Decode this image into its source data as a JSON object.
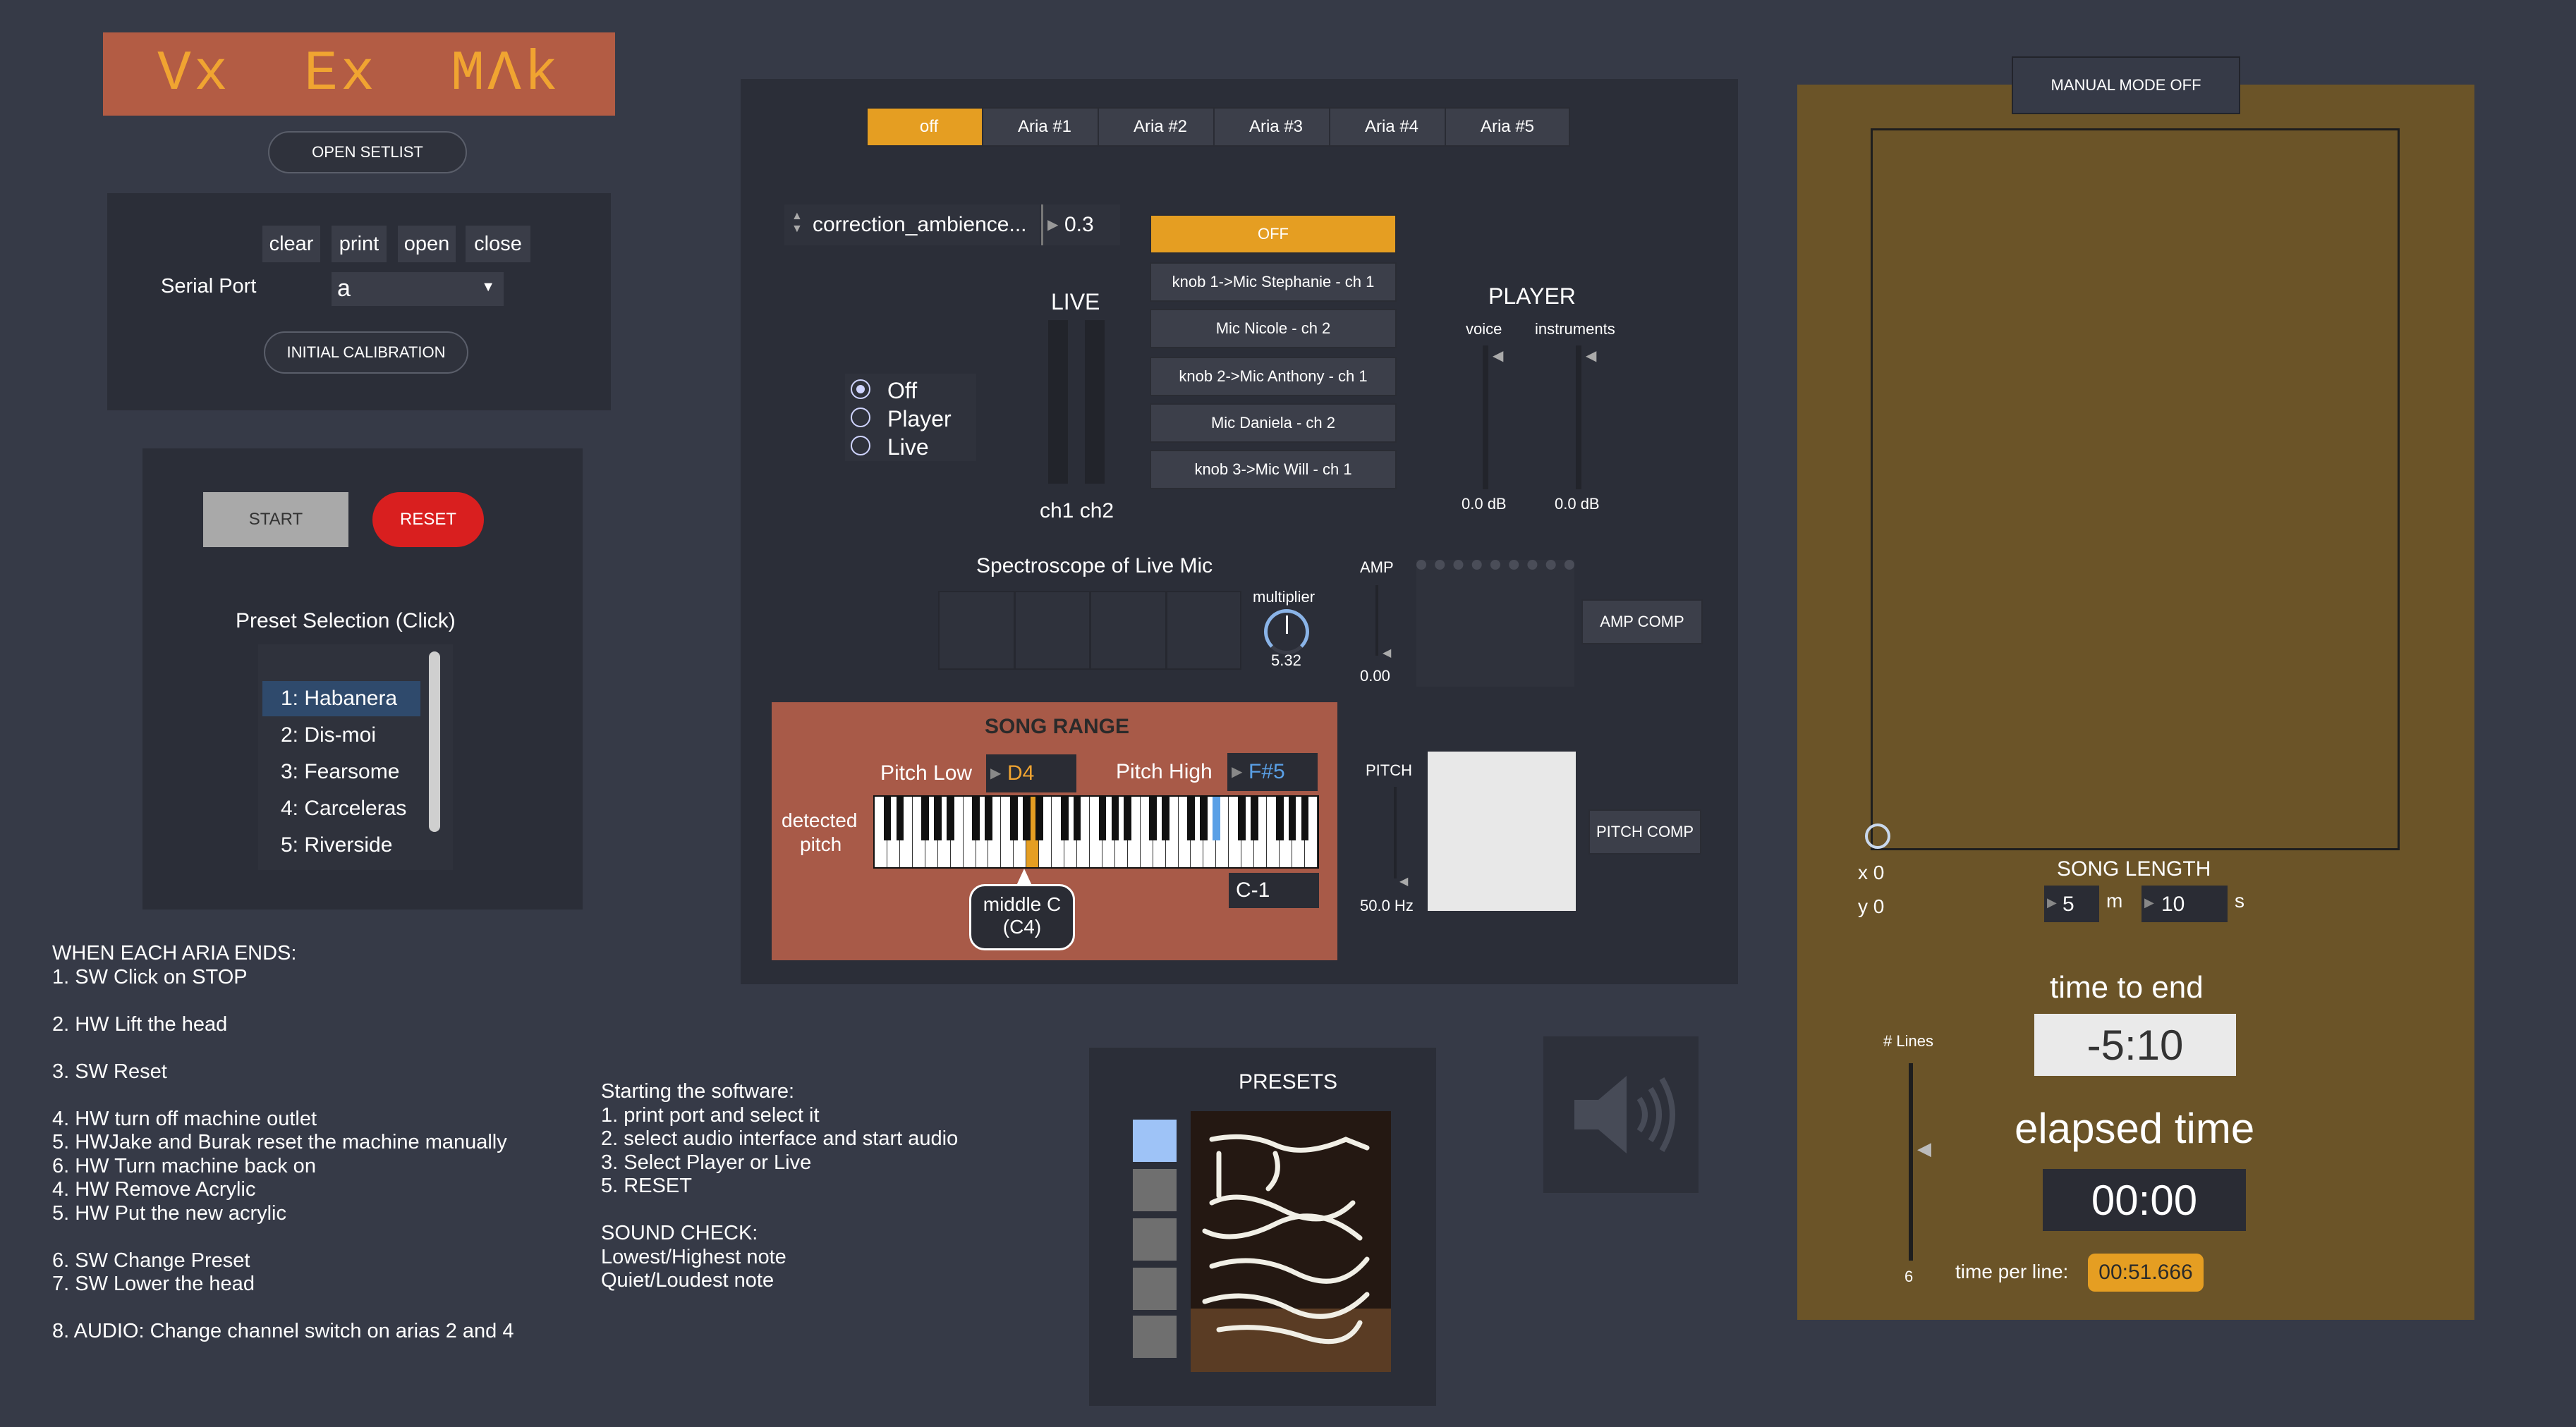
{
  "header": {
    "title": "Vx  Ex  MΛk",
    "open_setlist": "OPEN SETLIST"
  },
  "serial": {
    "clear": "clear",
    "print": "print",
    "open": "open",
    "close": "close",
    "label": "Serial Port",
    "port_value": "a",
    "initial_calibration": "INITIAL CALIBRATION"
  },
  "transport": {
    "start": "START",
    "reset": "RESET"
  },
  "presets_list": {
    "title": "Preset Selection (Click)",
    "items": [
      "1: Habanera",
      "2: Dis-moi",
      "3: Fearsome",
      "4: Carceleras",
      "5: Riverside"
    ],
    "selected_index": 0
  },
  "notes_left": "WHEN EACH ARIA ENDS:\n1. SW Click on STOP\n\n2. HW Lift the head\n\n3. SW Reset\n\n4. HW turn off machine outlet\n5. HWJake and Burak reset the machine manually\n6. HW Turn machine back on\n4. HW Remove Acrylic\n5. HW Put the new acrylic\n\n6. SW Change Preset\n7. SW Lower the head\n\n8. AUDIO: Change channel switch on arias 2 and 4",
  "notes_mid": "Starting the software:\n1. print port and select it\n2. select audio interface and start audio\n3. Select Player or Live\n5. RESET\n\nSOUND CHECK:\nLowest/Highest note\nQuiet/Loudest note",
  "tabs": [
    "off",
    "Aria #1",
    "Aria #2",
    "Aria #3",
    "Aria #4",
    "Aria #5"
  ],
  "param": {
    "name": "correction_ambience...",
    "value": "0.3"
  },
  "mode": {
    "options": [
      "Off",
      "Player",
      "Live"
    ],
    "selected": "Off"
  },
  "live": {
    "title": "LIVE",
    "channels": "ch1 ch2"
  },
  "mics": {
    "off_button": "OFF",
    "items": [
      "knob 1->Mic Stephanie - ch 1",
      "Mic Nicole - ch 2",
      "knob 2->Mic Anthony - ch 1",
      "Mic Daniela - ch 2",
      "knob 3->Mic Will - ch 1"
    ]
  },
  "player": {
    "title": "PLAYER",
    "voice": "voice",
    "instruments": "instruments",
    "voice_db": "0.0 dB",
    "instruments_db": "0.0 dB"
  },
  "spectroscope": {
    "title": "Spectroscope of Live Mic",
    "multiplier_label": "multiplier",
    "multiplier_value": "5.32"
  },
  "amp": {
    "label": "AMP",
    "value": "0.00",
    "comp_button": "AMP COMP"
  },
  "pitch": {
    "label": "PITCH",
    "value": "50.0 Hz",
    "comp_button": "PITCH COMP"
  },
  "song_range": {
    "title": "SONG RANGE",
    "pitch_low_label": "Pitch Low",
    "pitch_low": "D4",
    "pitch_high_label": "Pitch High",
    "pitch_high": "F#5",
    "detected_label_1": "detected",
    "detected_label_2": "pitch",
    "middle_c_1": "middle C",
    "middle_c_2": "(C4)",
    "detected_note": "C-1"
  },
  "presets_panel": {
    "title": "PRESETS"
  },
  "manual": {
    "mode_button": "MANUAL MODE OFF",
    "x_label": "x 0",
    "y_label": "y 0",
    "song_length_label": "SONG LENGTH",
    "minutes": "5",
    "m": "m",
    "seconds": "10",
    "s": "s",
    "time_to_end_label": "time to end",
    "time_to_end": "-5:10",
    "elapsed_label": "elapsed time",
    "elapsed": "00:00",
    "lines_label": "# Lines",
    "lines_value": "6",
    "time_per_line_label": "time per line:",
    "time_per_line": "00:51.666"
  },
  "colors": {
    "background": "#363a47",
    "panel": "#2b2e38",
    "accent_orange": "#e59e22",
    "song_range_bg": "#a85a48",
    "title_bg": "#b35c44",
    "title_text": "#f0a431",
    "manual_bg": "#6b5428",
    "reset_red": "#d91f1f",
    "key_highlight_blue": "#5aa0e6"
  }
}
